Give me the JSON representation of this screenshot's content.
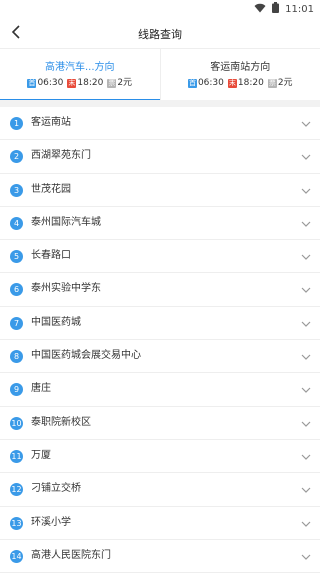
{
  "status_bar": {
    "time": "11:01"
  },
  "header": {
    "title": "线路查询"
  },
  "directions": [
    {
      "name": "高港汽车...方向",
      "first_tag": "首",
      "first_time": "06:30",
      "last_tag": "末",
      "last_time": "18:20",
      "fare_tag": "票",
      "fare": "2元",
      "active": true
    },
    {
      "name": "客运南站方向",
      "first_tag": "首",
      "first_time": "06:30",
      "last_tag": "末",
      "last_time": "18:20",
      "fare_tag": "票",
      "fare": "2元",
      "active": false
    }
  ],
  "stops": [
    {
      "num": "1",
      "name": "客运南站"
    },
    {
      "num": "2",
      "name": "西湖翠苑东门"
    },
    {
      "num": "3",
      "name": "世茂花园"
    },
    {
      "num": "4",
      "name": "泰州国际汽车城"
    },
    {
      "num": "5",
      "name": "长春路口"
    },
    {
      "num": "6",
      "name": "泰州实验中学东"
    },
    {
      "num": "7",
      "name": "中国医药城"
    },
    {
      "num": "8",
      "name": "中国医药城会展交易中心"
    },
    {
      "num": "9",
      "name": "唐庄"
    },
    {
      "num": "10",
      "name": "泰职院新校区"
    },
    {
      "num": "11",
      "name": "万厦"
    },
    {
      "num": "12",
      "name": "刁铺立交桥"
    },
    {
      "num": "13",
      "name": "环溪小学"
    },
    {
      "num": "14",
      "name": "高港人民医院东门"
    }
  ],
  "colors": {
    "accent": "#2a8ee8",
    "first_tag": "#3a9ae8",
    "last_tag": "#e84b3a",
    "fare_tag": "#b5b5b5"
  },
  "icons": {
    "back": "chevron-left-icon",
    "expand": "chevron-down-icon",
    "wifi": "wifi-icon",
    "battery": "battery-icon"
  }
}
